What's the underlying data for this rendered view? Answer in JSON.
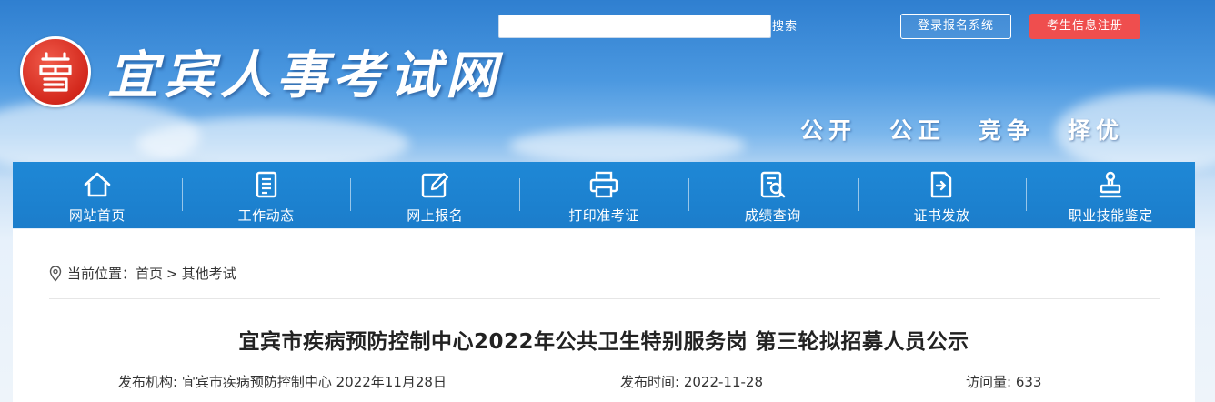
{
  "header": {
    "site_title": "宜宾人事考试网",
    "search": {
      "placeholder": "",
      "value": "",
      "button_label": "搜索"
    },
    "login_label": "登录报名系统",
    "register_label": "考生信息注册",
    "slogans": [
      "公开",
      "公正",
      "竞争",
      "择优"
    ]
  },
  "nav": {
    "items": [
      {
        "label": "网站首页",
        "icon": "home-icon"
      },
      {
        "label": "工作动态",
        "icon": "document-list-icon"
      },
      {
        "label": "网上报名",
        "icon": "edit-icon"
      },
      {
        "label": "打印准考证",
        "icon": "printer-icon"
      },
      {
        "label": "成绩查询",
        "icon": "search-document-icon"
      },
      {
        "label": "证书发放",
        "icon": "file-export-icon"
      },
      {
        "label": "职业技能鉴定",
        "icon": "stamp-icon"
      }
    ]
  },
  "breadcrumb": {
    "prefix": "当前位置：",
    "home": "首页",
    "separator": ">",
    "current": "其他考试"
  },
  "article": {
    "title": "宜宾市疾病预防控制中心2022年公共卫生特别服务岗 第三轮拟招募人员公示",
    "publisher_label": "发布机构:",
    "publisher_value": "宜宾市疾病预防控制中心 2022年11月28日",
    "time_label": "发布时间:",
    "time_value": "2022-11-28",
    "visits_label": "访问量:",
    "visits_value": "633"
  },
  "colors": {
    "nav_bg": "#1b7dcb",
    "register_bg": "#ef4e4e",
    "seal_red": "#d3281c"
  }
}
